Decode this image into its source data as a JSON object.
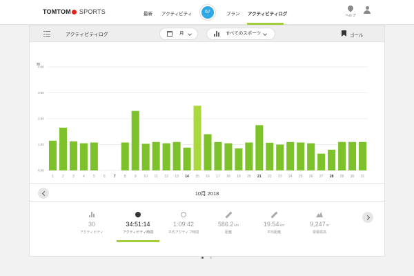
{
  "brand": {
    "name": "TOMTOM",
    "product": "SPORTS"
  },
  "nav": {
    "items": [
      {
        "label": "最新",
        "active": false
      },
      {
        "label": "アクティビティ",
        "active": false
      },
      {
        "label": "プラン",
        "active": false
      },
      {
        "label": "アクティビティログ",
        "active": true
      }
    ],
    "score": "67",
    "help_label": "ヘルプ",
    "accent": "#a5cf3a",
    "score_color": "#2ea8e6"
  },
  "toolbar": {
    "title": "アクティビティログ",
    "period": "月",
    "sport": "すべてのスポーツ",
    "goal": "ゴール"
  },
  "chart_data": {
    "type": "bar",
    "ylabel": "時",
    "yticks": [
      "0:00",
      "1:00",
      "2:00",
      "3:00",
      "4:00"
    ],
    "ylim": [
      0,
      4
    ],
    "grid": true,
    "categories": [
      "1",
      "2",
      "3",
      "4",
      "5",
      "6",
      "7",
      "8",
      "9",
      "10",
      "11",
      "12",
      "13",
      "14",
      "15",
      "16",
      "17",
      "18",
      "19",
      "20",
      "21",
      "22",
      "23",
      "24",
      "25",
      "26",
      "27",
      "28",
      "29",
      "30",
      "31"
    ],
    "bold_categories": [
      "7",
      "14",
      "21",
      "28"
    ],
    "values": [
      1.15,
      1.65,
      1.12,
      1.05,
      1.08,
      0,
      0,
      1.08,
      2.3,
      1.03,
      1.1,
      1.05,
      1.1,
      0.88,
      2.5,
      1.4,
      1.1,
      1.05,
      0.85,
      1.08,
      1.75,
      1.07,
      1.0,
      1.1,
      1.08,
      1.05,
      0.65,
      0.8,
      1.1,
      1.1,
      1.1
    ],
    "bar_color": "#7dc22b",
    "highlight_color": "#a9d93d"
  },
  "month_nav": {
    "label": "10月 2018"
  },
  "stats": [
    {
      "value": "30",
      "unit": "",
      "label": "アクティビティ",
      "icon": "bar-chart-icon",
      "selected": false
    },
    {
      "value": "34:51:14",
      "unit": "",
      "label": "アクティビティ時間",
      "icon": "stopwatch-icon",
      "selected": true
    },
    {
      "value": "1:09:42",
      "unit": "",
      "label": "平均アクティブ時間",
      "icon": "avg-stopwatch-icon",
      "selected": false
    },
    {
      "value": "586.2",
      "unit": "km",
      "label": "距離",
      "icon": "ruler-icon",
      "selected": false
    },
    {
      "value": "19.54",
      "unit": "km",
      "label": "平均距離",
      "icon": "avg-ruler-icon",
      "selected": false
    },
    {
      "value": "9,247",
      "unit": "m",
      "label": "累積標高",
      "icon": "mountain-icon",
      "selected": false
    }
  ]
}
